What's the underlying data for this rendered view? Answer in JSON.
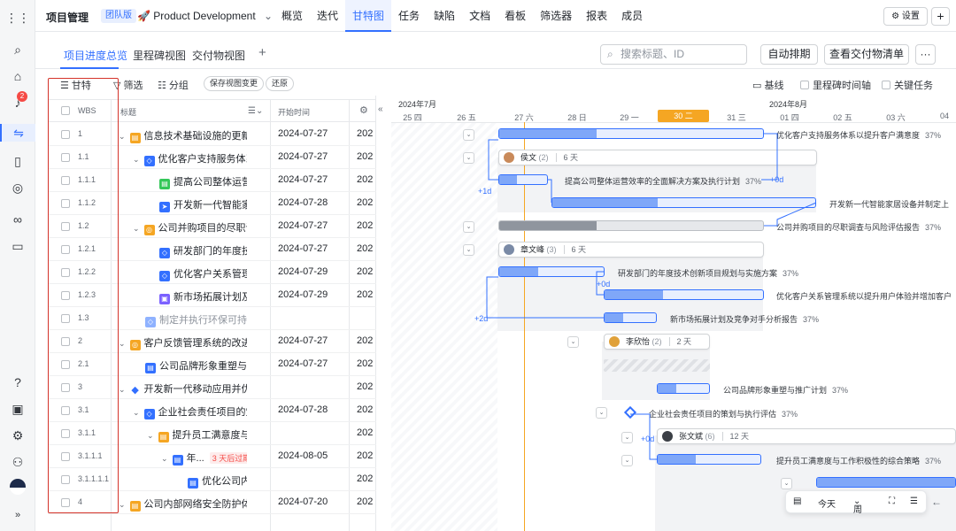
{
  "header": {
    "title": "项目管理",
    "edition_tag": "团队版",
    "project_name": "Product Development",
    "nav": [
      "概览",
      "迭代",
      "甘特图",
      "任务",
      "缺陷",
      "文档",
      "看板",
      "筛选器",
      "报表",
      "成员"
    ],
    "active_nav": "甘特图",
    "settings_label": "设置",
    "plus_label": "+"
  },
  "rail": {
    "notification_count": "2",
    "expand_label": "»"
  },
  "views": {
    "tabs": [
      "项目进度总览",
      "里程碑视图",
      "交付物视图"
    ],
    "add_label": "+",
    "search_placeholder": "搜索标题、ID",
    "auto_schedule": "自动排期",
    "deliverables": "查看交付物清单",
    "more": "···"
  },
  "toolbar": {
    "gantt_label": "甘特",
    "filter_label": "筛选",
    "group_label": "分组",
    "save_view": "保存视图变更",
    "restore": "还原",
    "baseline": "基线",
    "milestone_axis": "里程碑时间轴",
    "critical": "关键任务"
  },
  "grid": {
    "col_wbs": "WBS",
    "col_title": "标题",
    "col_start": "开始时间",
    "rows": [
      {
        "wbs": "1",
        "title": "信息技术基础设施的更新...",
        "start": "2024-07-27",
        "year": "202"
      },
      {
        "wbs": "1.1",
        "title": "优化客户支持服务体系...",
        "start": "2024-07-27",
        "year": "202"
      },
      {
        "wbs": "1.1.1",
        "title": "提高公司整体运营...",
        "start": "2024-07-27",
        "year": "202"
      },
      {
        "wbs": "1.1.2",
        "title": "开发新一代智能家...",
        "start": "2024-07-28",
        "year": "202"
      },
      {
        "wbs": "1.2",
        "title": "公司并购项目的尽职调...",
        "start": "2024-07-27",
        "year": "202"
      },
      {
        "wbs": "1.2.1",
        "title": "研发部门的年度技...",
        "start": "2024-07-27",
        "year": "202"
      },
      {
        "wbs": "1.2.2",
        "title": "优化客户关系管理...",
        "start": "2024-07-29",
        "year": "202"
      },
      {
        "wbs": "1.2.3",
        "title": "新市场拓展计划及...",
        "start": "2024-07-29",
        "year": "202"
      },
      {
        "wbs": "1.3",
        "title": "制定并执行环保可持续...",
        "start": "",
        "year": ""
      },
      {
        "wbs": "2",
        "title": "客户反馈管理系统的改进...",
        "start": "2024-07-27",
        "year": "202"
      },
      {
        "wbs": "2.1",
        "title": "公司品牌形象重塑与推...",
        "start": "2024-07-27",
        "year": "202"
      },
      {
        "wbs": "3",
        "title": "开发新一代移动应用并优...",
        "start": "",
        "year": "202"
      },
      {
        "wbs": "3.1",
        "title": "企业社会责任项目的策...",
        "start": "2024-07-28",
        "year": "202"
      },
      {
        "wbs": "3.1.1",
        "title": "提升员工满意度与...",
        "start": "",
        "year": "202"
      },
      {
        "wbs": "3.1.1.1",
        "title": "年...",
        "overdue": "3 天后过期",
        "start": "2024-08-05",
        "year": "202"
      },
      {
        "wbs": "3.1.1.1.1",
        "title": "优化公司内...",
        "start": "",
        "year": "202"
      },
      {
        "wbs": "4",
        "title": "公司内部网络安全防护体...",
        "start": "2024-07-20",
        "year": "202"
      }
    ]
  },
  "timeline": {
    "month1": "2024年7月",
    "month2": "2024年8月",
    "days": [
      "25 四",
      "26 五",
      "27 六",
      "28 日",
      "29 一",
      "30 二",
      "31 三",
      "01 四",
      "02 五",
      "03 六",
      "04"
    ],
    "today": "30 二"
  },
  "bars": {
    "b1": {
      "label": "优化客户支持服务体系以提升客户满意度",
      "pct": "37%"
    },
    "b2": {
      "label": "提高公司整体运营效率的全面解决方案及执行计划",
      "pct": "37%"
    },
    "b3": {
      "label": "开发新一代智能家居设备并制定上"
    },
    "b4": {
      "label": "公司并购项目的尽职调查与风险评估报告",
      "pct": "37%"
    },
    "b5": {
      "label": "研发部门的年度技术创新项目规划与实施方案",
      "pct": "37%"
    },
    "b6": {
      "label": "优化客户关系管理系统以提升用户体验并增加客户"
    },
    "b7": {
      "label": "新市场拓展计划及竞争对手分析报告",
      "pct": "37%"
    },
    "b8": {
      "label": "公司品牌形象重塑与推广计划",
      "pct": "37%"
    },
    "b9": {
      "label": "企业社会责任项目的策划与执行评估",
      "pct": "37%"
    },
    "b10": {
      "label": "提升员工满意度与工作积极性的综合策略",
      "pct": "37%"
    }
  },
  "cards": {
    "c1": {
      "name": "侯文",
      "count": "(2)",
      "dur": "6 天"
    },
    "c2": {
      "name": "章文峰",
      "count": "(3)",
      "dur": "6 天"
    },
    "c3": {
      "name": "李欣怡",
      "count": "(2)",
      "dur": "2 天"
    },
    "c4": {
      "name": "张文斌",
      "count": "(6)",
      "dur": "12 天"
    }
  },
  "deps": {
    "d1": "+1d",
    "d2": "+0d",
    "d3": "+0d",
    "d4": "+2d",
    "d5": "+0d"
  },
  "bottom": {
    "today": "今天",
    "week": "周"
  }
}
